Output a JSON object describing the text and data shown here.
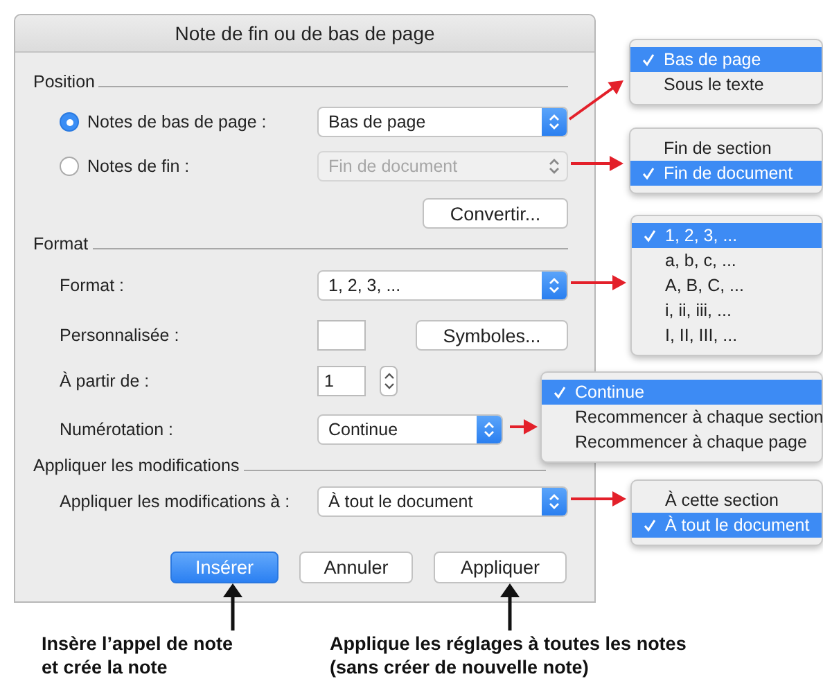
{
  "window": {
    "title": "Note de fin ou de bas de page"
  },
  "position": {
    "heading": "Position",
    "options": [
      {
        "label": "Notes de bas de page :",
        "selected": true,
        "popup": {
          "value": "Bas de page",
          "disabled": false
        }
      },
      {
        "label": "Notes de fin :",
        "selected": false,
        "popup": {
          "value": "Fin de document",
          "disabled": true
        }
      }
    ],
    "button": "Convertir..."
  },
  "format": {
    "heading": "Format",
    "format": {
      "label": "Format :",
      "value": "1, 2, 3, ..."
    },
    "custom": {
      "label": "Personnalisée :",
      "button": "Symboles..."
    },
    "start": {
      "label": "À partir de :",
      "value": "1"
    },
    "numbering": {
      "label": "Numérotation :",
      "value": "Continue"
    }
  },
  "apply": {
    "heading": "Appliquer les modifications",
    "label": "Appliquer les modifications à :",
    "value": "À tout le document"
  },
  "buttons": [
    {
      "label": "Insérer",
      "default": true
    },
    {
      "label": "Annuler",
      "default": false
    },
    {
      "label": "Appliquer",
      "default": false
    }
  ],
  "menus": [
    {
      "items": [
        {
          "label": "Bas de page",
          "selected": true
        },
        {
          "label": "Sous le texte",
          "selected": false
        }
      ]
    },
    {
      "items": [
        {
          "label": "Fin de section",
          "selected": false
        },
        {
          "label": "Fin de document",
          "selected": true
        }
      ]
    },
    {
      "items": [
        {
          "label": "1, 2, 3, ...",
          "selected": true
        },
        {
          "label": "a, b, c, ...",
          "selected": false
        },
        {
          "label": "A, B, C, ...",
          "selected": false
        },
        {
          "label": "i, ii, iii, ...",
          "selected": false
        },
        {
          "label": "I, II, III, ...",
          "selected": false
        }
      ]
    },
    {
      "items": [
        {
          "label": "Continue",
          "selected": true
        },
        {
          "label": "Recommencer à chaque section",
          "selected": false
        },
        {
          "label": "Recommencer à chaque page",
          "selected": false
        }
      ]
    },
    {
      "items": [
        {
          "label": "À cette section",
          "selected": false
        },
        {
          "label": "À tout le document",
          "selected": true
        }
      ]
    }
  ],
  "captions": [
    {
      "lines": [
        "Insère l’appel de note",
        "et crée la note"
      ]
    },
    {
      "lines": [
        "Applique les réglages à toutes les notes",
        "(sans créer de nouvelle note)"
      ]
    }
  ]
}
